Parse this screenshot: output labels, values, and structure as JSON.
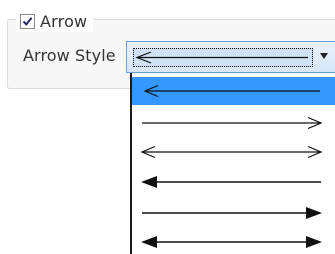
{
  "group": {
    "title": "Arrow",
    "checked": true
  },
  "arrow_style": {
    "label": "Arrow Style",
    "selected_option": "left-open-arrow",
    "options": [
      {
        "name": "left-open-arrow",
        "selected": true
      },
      {
        "name": "right-open-arrow",
        "selected": false
      },
      {
        "name": "double-open-arrow",
        "selected": false
      },
      {
        "name": "left-filled-arrow",
        "selected": false
      },
      {
        "name": "right-filled-arrow",
        "selected": false
      },
      {
        "name": "double-filled-arrow",
        "selected": false
      }
    ]
  },
  "colors": {
    "selection": "#3399ff",
    "combo_border": "#6e9fd3",
    "line": "#111111"
  }
}
